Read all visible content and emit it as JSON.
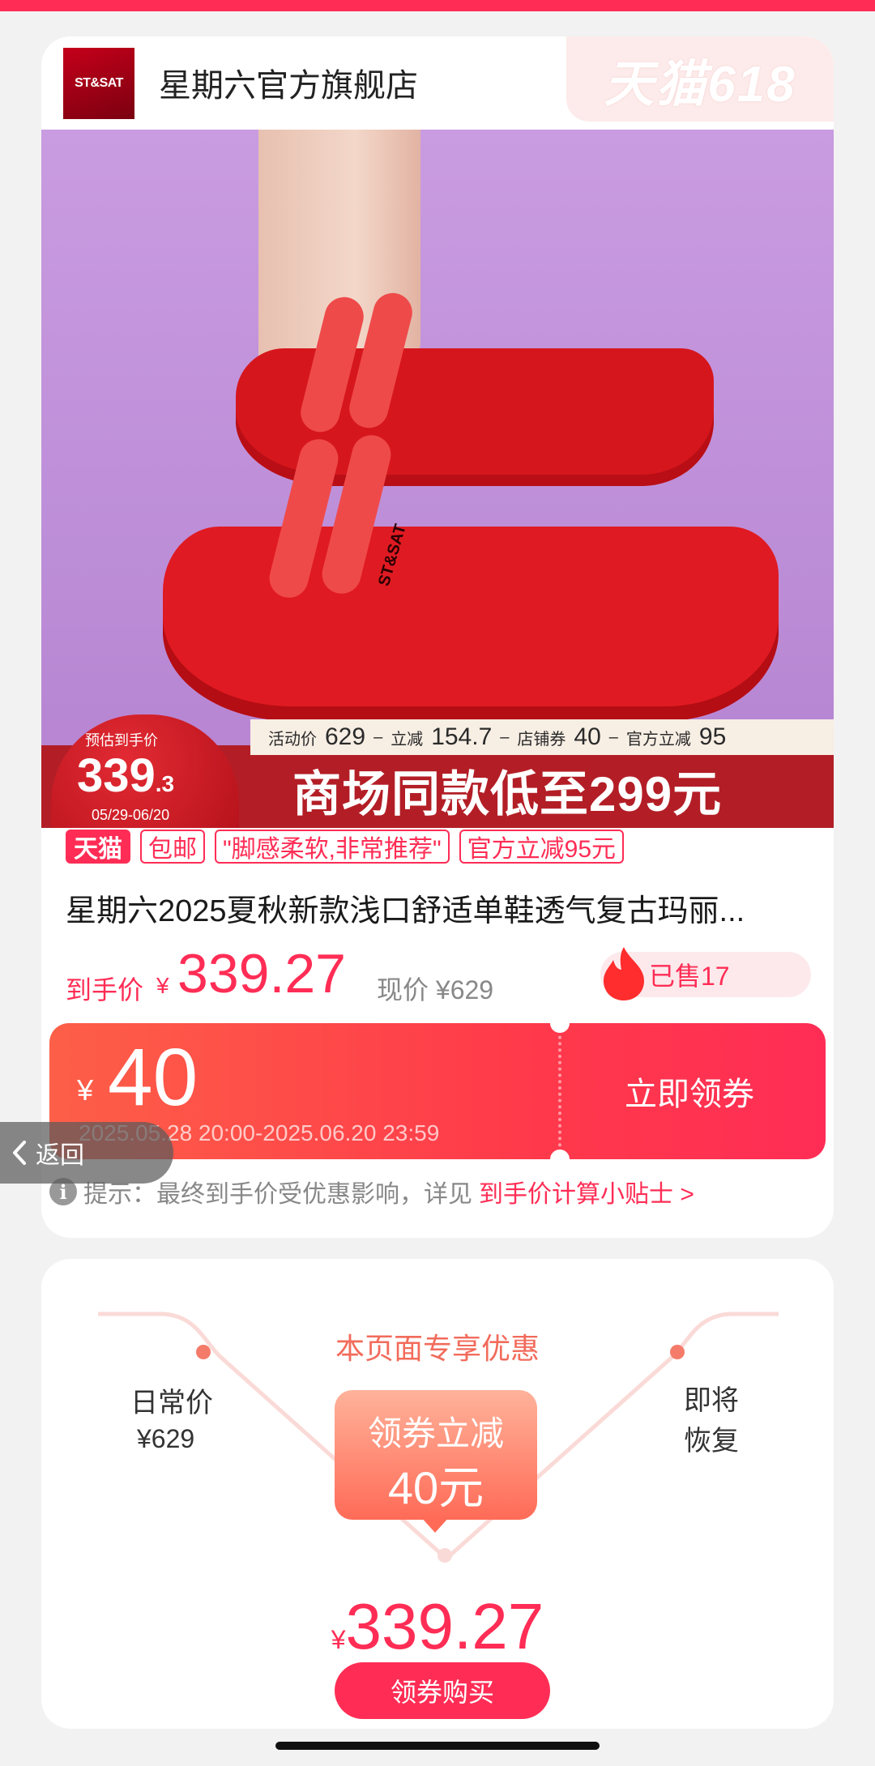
{
  "store": {
    "logo_text": "ST&SAT",
    "name": "星期六官方旗舰店",
    "event_badge": "天猫618"
  },
  "banner": {
    "est_label": "预估到手价",
    "est_price_main": "339",
    "est_price_decimal": ".3",
    "est_date": "05/29-06/20",
    "breakdown": [
      {
        "label": "活动价",
        "value": "629"
      },
      {
        "label": "立减",
        "value": "154.7"
      },
      {
        "label": "店铺券",
        "value": "40"
      },
      {
        "label": "官方立减",
        "value": "95"
      }
    ],
    "headline": "商场同款低至299元",
    "shoe_brand": "ST&SAT"
  },
  "tags": [
    "天猫",
    "包邮",
    "\"脚感柔软,非常推荐\"",
    "官方立减95元"
  ],
  "product": {
    "title": "星期六2025夏秋新款浅口舒适单鞋透气复古玛丽...",
    "final_price_label": "到手价",
    "currency": "¥",
    "final_price": "339.27",
    "current_price": "现价 ¥629",
    "sold": "已售17"
  },
  "coupon": {
    "currency": "¥",
    "amount": "40",
    "valid_time": "2025.05.28 20:00-2025.06.20 23:59",
    "button": "立即领券"
  },
  "tip": {
    "text": "提示：最终到手价受优惠影响，详见",
    "link": "到手价计算小贴士 >"
  },
  "back": "返回",
  "exclusive": {
    "title": "本页面专享优惠",
    "daily_label": "日常价",
    "daily_price": "¥629",
    "soon_label": "即将恢复",
    "bubble_line1": "领券立减",
    "bubble_line2": "40元",
    "currency": "¥",
    "final_price": "339.27",
    "buy_button": "领券购买"
  },
  "colors": {
    "accent": "#ff2d55",
    "coupon_start": "#fd5f48",
    "banner_red": "#b31e26",
    "hero_bg": "#c99be0"
  }
}
